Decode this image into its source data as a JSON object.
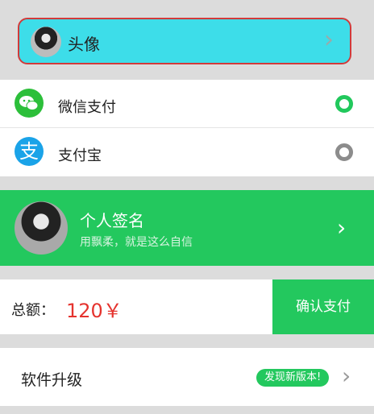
{
  "avatar_row": {
    "title": "头像",
    "chevron": "›"
  },
  "payment_methods": [
    {
      "label": "微信支付",
      "icon": "wechat-icon",
      "selected": true
    },
    {
      "label": "支付宝",
      "icon": "alipay-icon",
      "icon_char": "支",
      "selected": false
    }
  ],
  "signature": {
    "title": "个人签名",
    "subtitle": "用飘柔，就是这么自信",
    "chevron": "›"
  },
  "total": {
    "label": "总额：",
    "value": "120￥",
    "confirm_label": "确认支付"
  },
  "upgrade": {
    "label": "软件升级",
    "badge": "发现新版本!",
    "chevron": "›"
  },
  "colors": {
    "accent_green": "#23c85e",
    "cyan": "#3ddde9",
    "red": "#e5332e",
    "alipay_blue": "#1aa3e8"
  }
}
